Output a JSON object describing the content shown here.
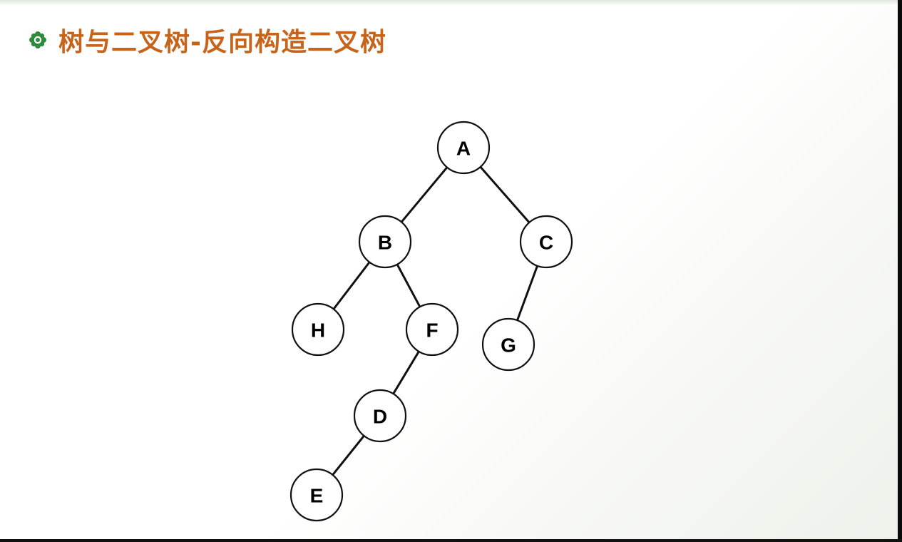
{
  "slide": {
    "title": "树与二叉树-反向构造二叉树",
    "bullet_icon": "flower-bullet-icon",
    "title_color": "#c8631a",
    "bullet_color": "#2e8b3d"
  },
  "tree": {
    "nodes": [
      {
        "id": "A",
        "label": "A"
      },
      {
        "id": "B",
        "label": "B"
      },
      {
        "id": "C",
        "label": "C"
      },
      {
        "id": "H",
        "label": "H"
      },
      {
        "id": "F",
        "label": "F"
      },
      {
        "id": "G",
        "label": "G"
      },
      {
        "id": "D",
        "label": "D"
      },
      {
        "id": "E",
        "label": "E"
      }
    ],
    "edges": [
      {
        "from": "A",
        "to": "B"
      },
      {
        "from": "A",
        "to": "C"
      },
      {
        "from": "B",
        "to": "H"
      },
      {
        "from": "B",
        "to": "F"
      },
      {
        "from": "C",
        "to": "G"
      },
      {
        "from": "F",
        "to": "D"
      },
      {
        "from": "D",
        "to": "E"
      }
    ]
  }
}
